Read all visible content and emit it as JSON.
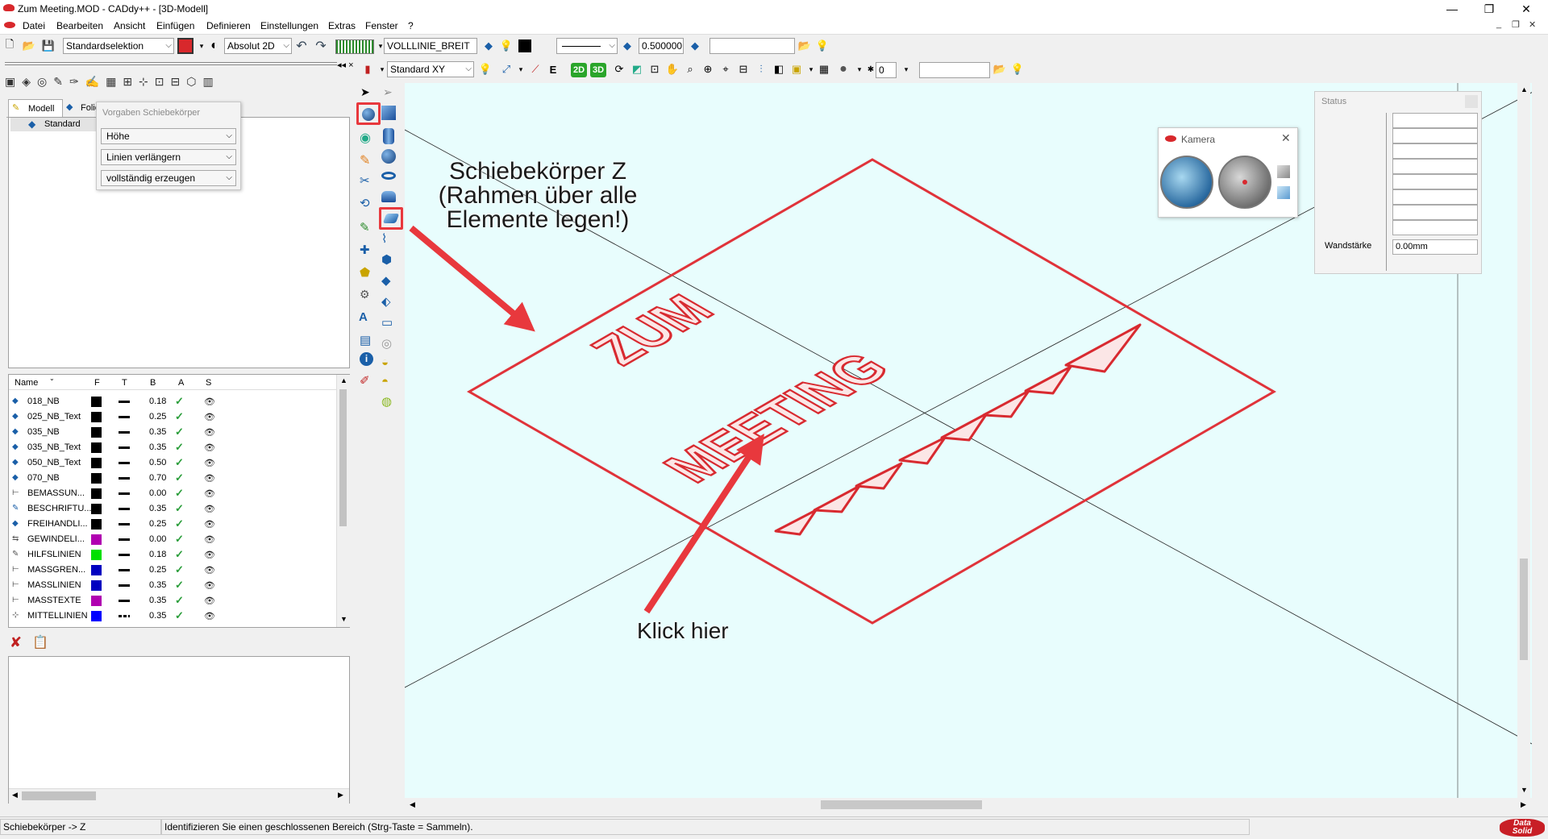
{
  "window": {
    "title": "Zum Meeting.MOD  -  CADdy++ - [3D-Modell]",
    "minimize": "—",
    "restore": "❐",
    "close": "✕"
  },
  "menu": [
    "Datei",
    "Bearbeiten",
    "Ansicht",
    "Einfügen",
    "Definieren",
    "Einstellungen",
    "Extras",
    "Fenster",
    "?"
  ],
  "toolbar1": {
    "selection": "Standardselektion",
    "coord_mode": "Absolut 2D",
    "linetype": "VOLLLINIE_BREIT",
    "linewidth": "0.500000"
  },
  "toolbar2": {
    "plane": "Standard XY",
    "number": "0",
    "mode_2d": "2D",
    "mode_3d": "3D",
    "arrow_e": "E"
  },
  "left_tabs": [
    "Modell",
    "Folie"
  ],
  "tree": {
    "root": "Standard"
  },
  "popup_schiebe": {
    "title": "Vorgaben Schiebekörper",
    "options": [
      "Höhe",
      "Linien verlängern",
      "vollständig erzeugen"
    ]
  },
  "layers": {
    "columns": [
      "Name",
      "F",
      "T",
      "B",
      "A",
      "S"
    ],
    "rows": [
      {
        "name": "018_NB",
        "color": "#000000",
        "b": "0.18",
        "lt": "solid"
      },
      {
        "name": "025_NB_Text",
        "color": "#000000",
        "b": "0.25",
        "lt": "solid"
      },
      {
        "name": "035_NB",
        "color": "#000000",
        "b": "0.35",
        "lt": "solid"
      },
      {
        "name": "035_NB_Text",
        "color": "#000000",
        "b": "0.35",
        "lt": "solid"
      },
      {
        "name": "050_NB_Text",
        "color": "#000000",
        "b": "0.50",
        "lt": "solid"
      },
      {
        "name": "070_NB",
        "color": "#000000",
        "b": "0.70",
        "lt": "solid"
      },
      {
        "name": "BEMASSUN...",
        "color": "#000000",
        "b": "0.00",
        "lt": "solid"
      },
      {
        "name": "BESCHRIFTU...",
        "color": "#000000",
        "b": "0.35",
        "lt": "solid"
      },
      {
        "name": "FREIHANDLI...",
        "color": "#000000",
        "b": "0.25",
        "lt": "solid"
      },
      {
        "name": "GEWINDELI...",
        "color": "#b000b0",
        "b": "0.00",
        "lt": "solid"
      },
      {
        "name": "HILFSLINIEN",
        "color": "#00e000",
        "b": "0.18",
        "lt": "solid"
      },
      {
        "name": "MASSGREN...",
        "color": "#0000c0",
        "b": "0.25",
        "lt": "solid"
      },
      {
        "name": "MASSLINIEN",
        "color": "#0000c0",
        "b": "0.35",
        "lt": "solid"
      },
      {
        "name": "MASSTEXTE",
        "color": "#b000b0",
        "b": "0.35",
        "lt": "solid"
      },
      {
        "name": "MITTELLINIEN",
        "color": "#0000ff",
        "b": "0.35",
        "lt": "dashdot"
      }
    ]
  },
  "canvas_text": {
    "model_text_1": "ZUM",
    "model_text_2": "MEETING"
  },
  "annotations": {
    "callout_top": [
      "Schiebekörper Z",
      "(Rahmen über alle",
      "Elemente legen!)"
    ],
    "callout_bottom": "Klick hier",
    "annotation_color": "#e8383d"
  },
  "kamera": {
    "title": "Kamera"
  },
  "status_panel": {
    "title": "Status",
    "label": "Wandstärke",
    "value": "0.00mm"
  },
  "statusbar": {
    "command": "Schiebekörper -> Z",
    "prompt": "Identifizieren Sie einen geschlossenen Bereich (Strg-Taste = Sammeln).",
    "brand_1": "Data",
    "brand_2": "Solid"
  }
}
